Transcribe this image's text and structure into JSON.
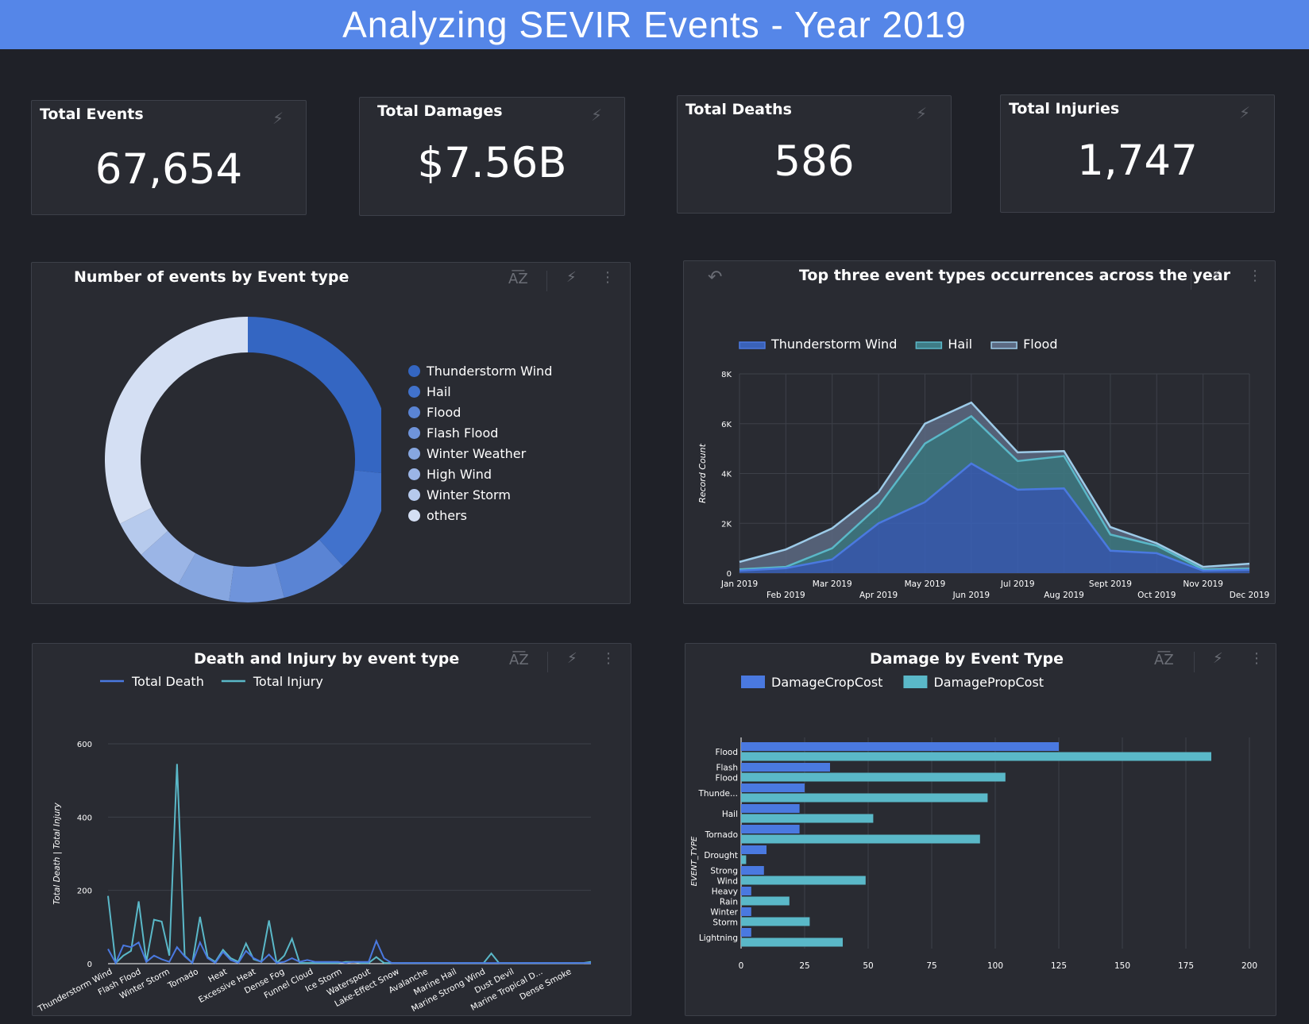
{
  "header": {
    "title": "Analyzing SEVIR Events - Year 2019"
  },
  "kpis": [
    {
      "title": "Total Events",
      "value": "67,654"
    },
    {
      "title": "Total Damages",
      "value": "$7.56B"
    },
    {
      "title": "Total Deaths",
      "value": "586"
    },
    {
      "title": "Total Injuries",
      "value": "1,747"
    }
  ],
  "icons": {
    "sort": "sort-az-icon",
    "bolt": "bolt-icon",
    "more": "more-vert-icon",
    "undo": "undo-icon"
  },
  "colors": {
    "accent": "#5586e8",
    "series_blue": "#4a79e0",
    "series_teal": "#5ab8c8",
    "series_light": "#9dcbe8"
  },
  "chart_data": [
    {
      "type": "pie",
      "title": "Number of events by Event type",
      "donut": true,
      "categories": [
        "Thunderstorm Wind",
        "Hail",
        "Flood",
        "Flash Flood",
        "Winter Weather",
        "High Wind",
        "Winter Storm",
        "others"
      ],
      "values": [
        26.6,
        11.8,
        7.5,
        6.2,
        6.0,
        5.3,
        4.2,
        32.4
      ],
      "colors": [
        "#3466c2",
        "#4172cc",
        "#5a84d4",
        "#6f94db",
        "#86a6e0",
        "#9bb5e6",
        "#b6caed",
        "#d4dff3"
      ],
      "legend_position": "right"
    },
    {
      "type": "area",
      "title": "Top three event types occurrences across the year",
      "x": [
        "Jan 2019",
        "Feb 2019",
        "Mar 2019",
        "Apr 2019",
        "May 2019",
        "Jun 2019",
        "Jul 2019",
        "Aug 2019",
        "Sept 2019",
        "Oct 2019",
        "Nov 2019",
        "Dec 2019"
      ],
      "stacked": true,
      "series": [
        {
          "name": "Thunderstorm Wind",
          "values": [
            100,
            200,
            550,
            2000,
            2850,
            4400,
            3350,
            3400,
            900,
            800,
            100,
            130
          ]
        },
        {
          "name": "Hail",
          "values": [
            50,
            50,
            450,
            700,
            2350,
            1900,
            1150,
            1300,
            650,
            300,
            50,
            50
          ]
        },
        {
          "name": "Flood",
          "values": [
            300,
            700,
            800,
            550,
            800,
            550,
            350,
            200,
            300,
            100,
            100,
            200
          ]
        }
      ],
      "ylabel": "Record Count",
      "ylim": [
        0,
        8000
      ],
      "yticks": [
        "0",
        "2K",
        "4K",
        "6K",
        "8K"
      ],
      "legend_position": "top-left",
      "grid": true
    },
    {
      "type": "line",
      "title": "Death and Injury by event type",
      "categories": [
        "Thunderstorm Wind",
        "",
        "Flash Flood",
        "",
        "Winter Storm",
        "",
        "Tornado",
        "",
        "Heat",
        "",
        "Excessive Heat",
        "",
        "Dense Fog",
        "",
        "Funnel Cloud",
        "",
        "Ice Storm",
        "",
        "Waterspout",
        "",
        "Lake-Effect Snow",
        "",
        "Avalanche",
        "",
        "Marine Hail",
        "",
        "Marine Strong Wind",
        "",
        "Dust Devil",
        "",
        "Marine Tropical D...",
        "",
        "Dense Smoke",
        ""
      ],
      "series": [
        {
          "name": "Total Death",
          "values": [
            40,
            2,
            50,
            45,
            58,
            5,
            22,
            12,
            5,
            45,
            20,
            2,
            58,
            15,
            2,
            32,
            10,
            2,
            35,
            15,
            5,
            25,
            2,
            5,
            15,
            5,
            10,
            5,
            5,
            5,
            5,
            2,
            5,
            5,
            5,
            62,
            15,
            2,
            2,
            2,
            2,
            2,
            2,
            2,
            2,
            2,
            2,
            2,
            2,
            2,
            2,
            2,
            2,
            2,
            2,
            2,
            2,
            2,
            2,
            2,
            2,
            2,
            2,
            2
          ]
        },
        {
          "name": "Total Injury",
          "values": [
            185,
            2,
            22,
            35,
            170,
            5,
            120,
            115,
            22,
            545,
            22,
            2,
            128,
            18,
            5,
            38,
            15,
            5,
            55,
            12,
            5,
            118,
            2,
            22,
            68,
            2,
            2,
            2,
            2,
            2,
            2,
            5,
            5,
            2,
            2,
            18,
            2,
            2,
            2,
            2,
            2,
            2,
            2,
            2,
            2,
            2,
            2,
            2,
            2,
            2,
            28,
            2,
            2,
            2,
            2,
            2,
            2,
            2,
            2,
            2,
            2,
            2,
            2,
            5
          ]
        }
      ],
      "xlabels": [
        "Thunderstorm Wind",
        "Flash Flood",
        "Winter Storm",
        "Tornado",
        "Heat",
        "Excessive Heat",
        "Dense Fog",
        "Funnel Cloud",
        "Ice Storm",
        "Waterspout",
        "Lake-Effect Snow",
        "Avalanche",
        "Marine Hail",
        "Marine Strong Wind",
        "Dust Devil",
        "Marine Tropical D...",
        "Dense Smoke"
      ],
      "ylabel": "Total Death | Total Injury",
      "ylim": [
        0,
        600
      ],
      "yticks": [
        "0",
        "200",
        "400",
        "600"
      ],
      "legend_position": "top-left",
      "grid": true
    },
    {
      "type": "bar",
      "orientation": "horizontal",
      "title": "Damage by Event Type",
      "categories": [
        [
          "Flood"
        ],
        [
          "Flash",
          "Flood"
        ],
        [
          "Thunde..."
        ],
        [
          "Hail"
        ],
        [
          "Tornado"
        ],
        [
          "Drought"
        ],
        [
          "Strong",
          "Wind"
        ],
        [
          "Heavy",
          "Rain"
        ],
        [
          "Winter",
          "Storm"
        ],
        [
          "Lightning"
        ]
      ],
      "series": [
        {
          "name": "DamageCropCost",
          "values": [
            125,
            35,
            25,
            23,
            23,
            10,
            9,
            4,
            4,
            4
          ]
        },
        {
          "name": "DamagePropCost",
          "values": [
            185,
            104,
            97,
            52,
            94,
            2,
            49,
            19,
            27,
            40
          ]
        }
      ],
      "ylabel": "EVENT_TYPE",
      "xlim": [
        0,
        200
      ],
      "xticks": [
        "0",
        "25",
        "50",
        "75",
        "100",
        "125",
        "150",
        "175",
        "200"
      ],
      "legend_position": "top-left",
      "grid": true
    }
  ]
}
